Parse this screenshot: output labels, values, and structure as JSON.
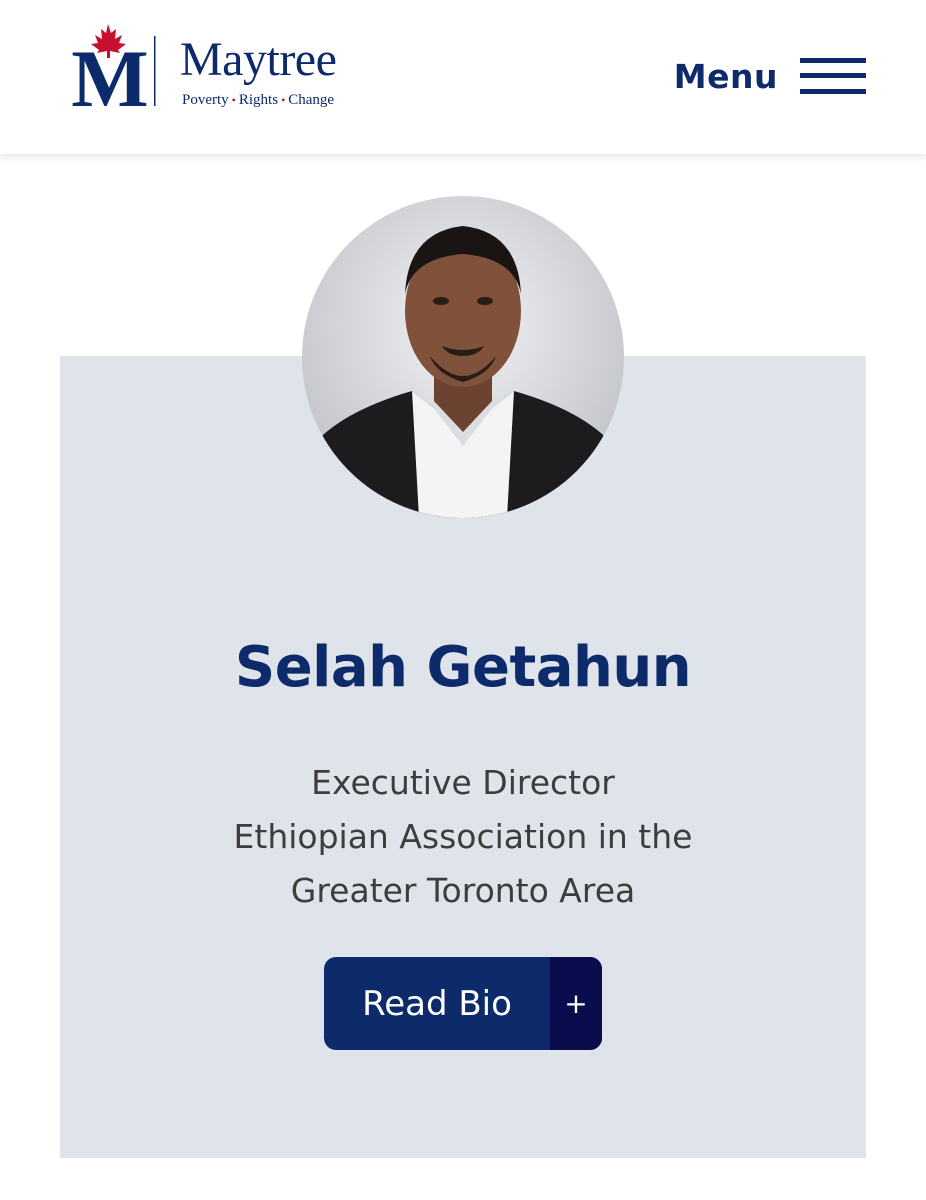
{
  "header": {
    "logo": {
      "letter": "M",
      "wordmark": "Maytree",
      "tagline_parts": [
        "Poverty",
        "Rights",
        "Change"
      ],
      "tagline_separator": "•"
    },
    "menu_label": "Menu"
  },
  "profile": {
    "name": "Selah Getahun",
    "role_lines": [
      "Executive Director",
      "Ethiopian Association in the",
      "Greater Toronto Area"
    ],
    "button": {
      "label": "Read Bio",
      "icon": "+"
    }
  },
  "colors": {
    "brand_navy": "#0d2a6b",
    "brand_red": "#c8102e",
    "card_bg": "#dfe3ea",
    "button_accent": "#0a0c4e",
    "body_text": "#3d3d3d"
  },
  "icons": {
    "menu": "hamburger-icon",
    "logo_leaf": "maple-leaf-icon",
    "bio_toggle": "plus-icon"
  }
}
